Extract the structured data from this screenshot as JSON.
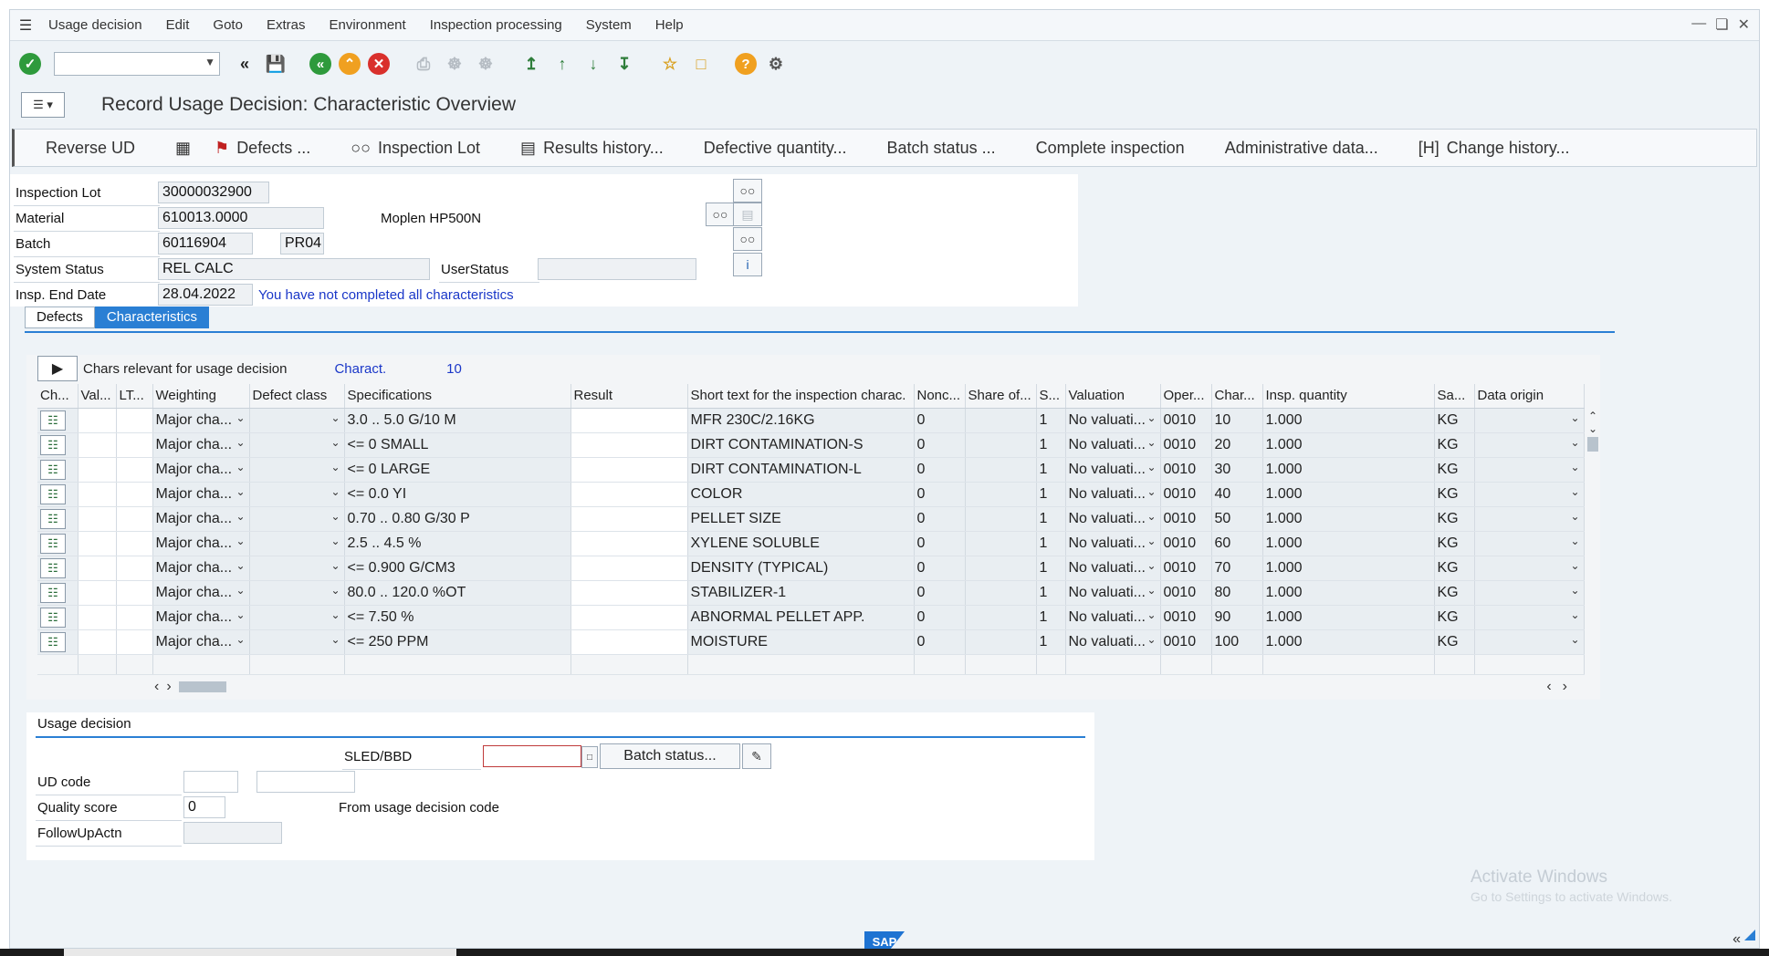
{
  "menu": {
    "items": [
      "Usage decision",
      "Edit",
      "Goto",
      "Extras",
      "Environment",
      "Inspection processing",
      "System",
      "Help"
    ]
  },
  "title": "Record Usage Decision: Characteristic Overview",
  "app_toolbar": {
    "reverse_ud": "Reverse UD",
    "defects": "Defects ...",
    "inspection_lot": "Inspection Lot",
    "results_history": "Results history...",
    "defective_quantity": "Defective quantity...",
    "batch_status": "Batch status ...",
    "complete_inspection": "Complete inspection",
    "administrative_data": "Administrative data...",
    "change_history": "Change history..."
  },
  "header": {
    "inspection_lot_label": "Inspection Lot",
    "inspection_lot_value": "30000032900",
    "material_label": "Material",
    "material_value": "610013.0000",
    "material_desc": "Moplen HP500N",
    "batch_label": "Batch",
    "batch_value": "60116904",
    "plant_value": "PR04",
    "system_status_label": "System Status",
    "system_status_value": "REL  CALC",
    "user_status_label": "UserStatus",
    "user_status_value": "",
    "insp_end_date_label": "Insp. End Date",
    "insp_end_date_value": "28.04.2022",
    "message": "You have not completed all characteristics"
  },
  "tabs": [
    "Defects",
    "Characteristics"
  ],
  "chars": {
    "relevant_label": "Chars relevant for usage decision",
    "charact_label": "Charact.",
    "charact_count": "10",
    "columns": [
      "Ch...",
      "Val...",
      "LT...",
      "Weighting",
      "Defect class",
      "Specifications",
      "Result",
      "Short text for the inspection charac.",
      "Nonc...",
      "Share of...",
      "S...",
      "Valuation",
      "Oper...",
      "Char...",
      "Insp. quantity",
      "Sa...",
      "Data origin"
    ],
    "rows": [
      {
        "weighting": "Major cha...",
        "spec": "3.0 .. 5.0 G/10 M",
        "short_text": "MFR 230C/2.16KG",
        "nonc": "0",
        "s": "1",
        "valuation": "No valuati...",
        "oper": "0010",
        "char": "10",
        "qty": "1.000",
        "unit": "KG"
      },
      {
        "weighting": "Major cha...",
        "spec": "<=  0 SMALL",
        "short_text": "DIRT CONTAMINATION-S",
        "nonc": "0",
        "s": "1",
        "valuation": "No valuati...",
        "oper": "0010",
        "char": "20",
        "qty": "1.000",
        "unit": "KG"
      },
      {
        "weighting": "Major cha...",
        "spec": "<=  0 LARGE",
        "short_text": "DIRT CONTAMINATION-L",
        "nonc": "0",
        "s": "1",
        "valuation": "No valuati...",
        "oper": "0010",
        "char": "30",
        "qty": "1.000",
        "unit": "KG"
      },
      {
        "weighting": "Major cha...",
        "spec": "<=  0.0 YI",
        "short_text": "COLOR",
        "nonc": "0",
        "s": "1",
        "valuation": "No valuati...",
        "oper": "0010",
        "char": "40",
        "qty": "1.000",
        "unit": "KG"
      },
      {
        "weighting": "Major cha...",
        "spec": "0.70 .. 0.80 G/30 P",
        "short_text": "PELLET SIZE",
        "nonc": "0",
        "s": "1",
        "valuation": "No valuati...",
        "oper": "0010",
        "char": "50",
        "qty": "1.000",
        "unit": "KG"
      },
      {
        "weighting": "Major cha...",
        "spec": "2.5 .. 4.5 %",
        "short_text": "XYLENE SOLUBLE",
        "nonc": "0",
        "s": "1",
        "valuation": "No valuati...",
        "oper": "0010",
        "char": "60",
        "qty": "1.000",
        "unit": "KG"
      },
      {
        "weighting": "Major cha...",
        "spec": "<=  0.900 G/CM3",
        "short_text": "DENSITY (TYPICAL)",
        "nonc": "0",
        "s": "1",
        "valuation": "No valuati...",
        "oper": "0010",
        "char": "70",
        "qty": "1.000",
        "unit": "KG"
      },
      {
        "weighting": "Major cha...",
        "spec": "80.0 .. 120.0 %OT",
        "short_text": "STABILIZER-1",
        "nonc": "0",
        "s": "1",
        "valuation": "No valuati...",
        "oper": "0010",
        "char": "80",
        "qty": "1.000",
        "unit": "KG"
      },
      {
        "weighting": "Major cha...",
        "spec": "<=  7.50 %",
        "short_text": "ABNORMAL PELLET APP.",
        "nonc": "0",
        "s": "1",
        "valuation": "No valuati...",
        "oper": "0010",
        "char": "90",
        "qty": "1.000",
        "unit": "KG"
      },
      {
        "weighting": "Major cha...",
        "spec": "<=  250 PPM",
        "short_text": "MOISTURE",
        "nonc": "0",
        "s": "1",
        "valuation": "No valuati...",
        "oper": "0010",
        "char": "100",
        "qty": "1.000",
        "unit": "KG"
      }
    ]
  },
  "usage_decision": {
    "title": "Usage decision",
    "sled_label": "SLED/BBD",
    "sled_value": "",
    "batch_status_button": "Batch status...",
    "ud_code_label": "UD code",
    "quality_score_label": "Quality score",
    "quality_score_value": "0",
    "from_ud_code": "From usage decision code",
    "followup_label": "FollowUpActn"
  },
  "watermark": {
    "line1": "Activate Windows",
    "line2": "Go to Settings to activate Windows."
  },
  "footer": {
    "logo": "SAP"
  }
}
